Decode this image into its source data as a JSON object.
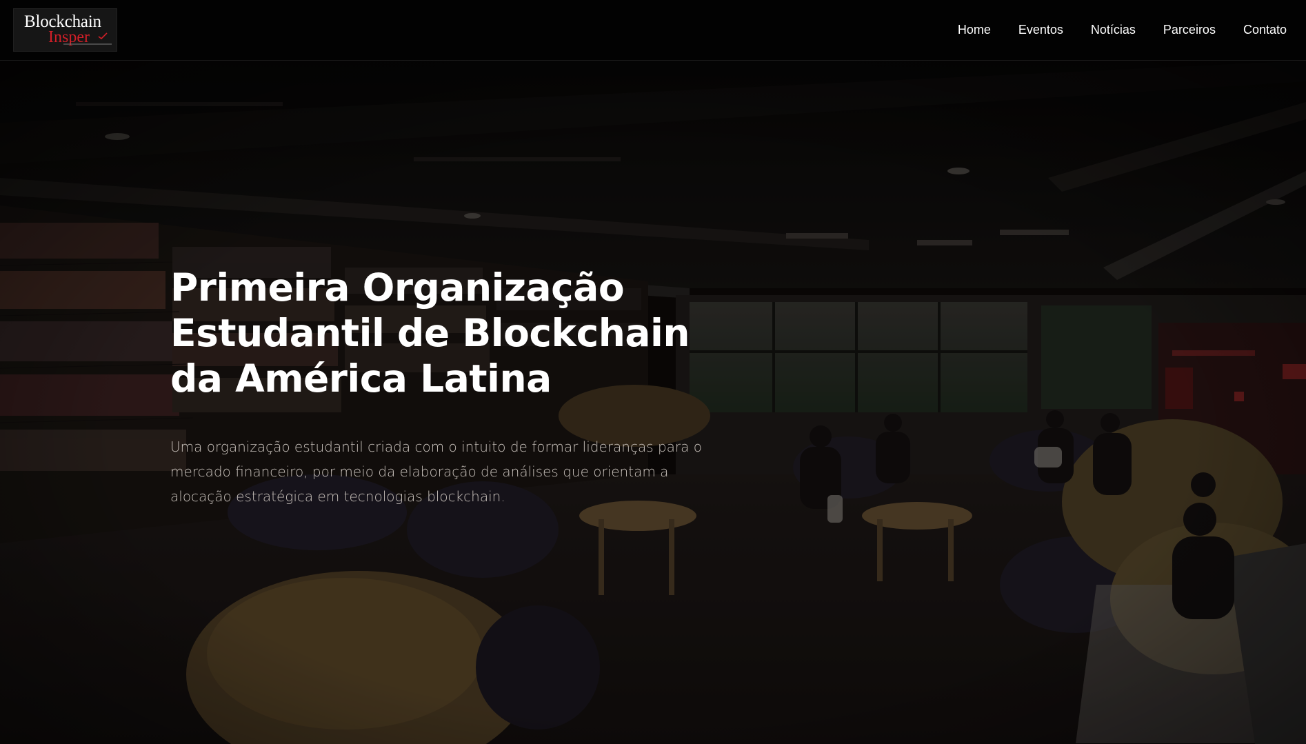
{
  "brand": {
    "logo_line1": "Blockchain",
    "logo_line2": "Insper",
    "accent_color": "#d21f28"
  },
  "nav": {
    "items": [
      {
        "label": "Home"
      },
      {
        "label": "Eventos"
      },
      {
        "label": "Notícias"
      },
      {
        "label": "Parceiros"
      },
      {
        "label": "Contato"
      }
    ]
  },
  "hero": {
    "title": "Primeira Organização Estudantil de Blockchain da América Latina",
    "description": "Uma organização estudantil criada com o intuito de formar lideranças para o mercado financeiro, por meio da elaboração de análises que orientam a alocação estratégica em tecnologias blockchain.",
    "background_icon": "library-photo"
  }
}
